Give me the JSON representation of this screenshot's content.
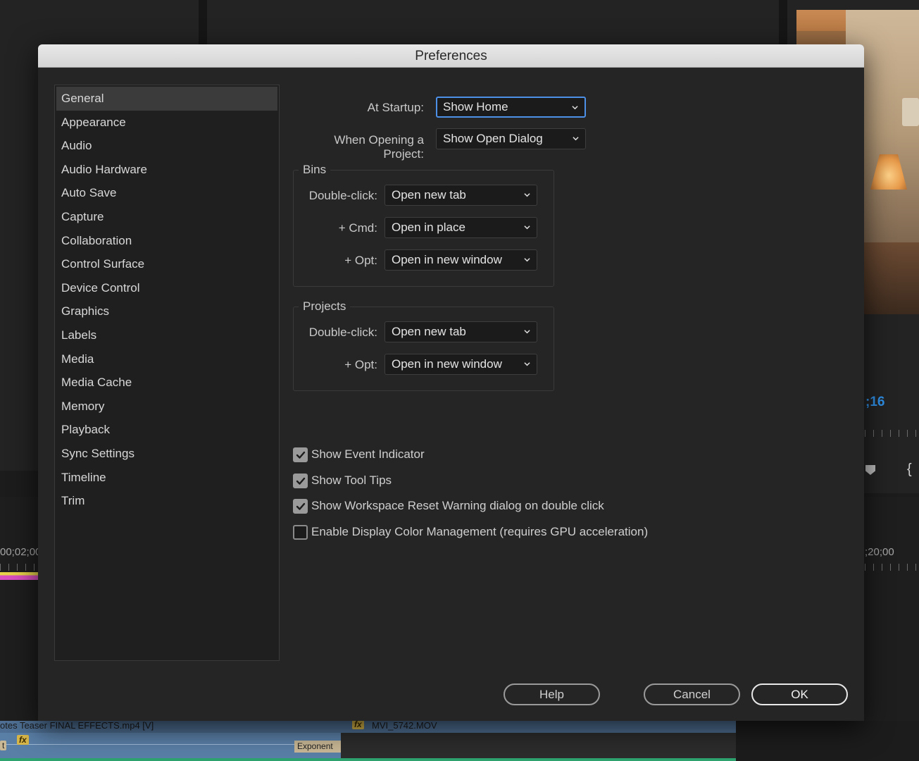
{
  "background": {
    "timecode": ";16",
    "timecode_left": "00;02;00",
    "timecode_right": ";20;00",
    "clip_label_1": "otes Teaser FINAL EFFECTS.mp4 [V]",
    "clip_label_2": "MVI_5742.MOV",
    "fx_label": "fx",
    "expo_label": "Exponent",
    "t_label": "t"
  },
  "dialog": {
    "title": "Preferences",
    "nav": [
      {
        "label": "General",
        "active": true
      },
      {
        "label": "Appearance"
      },
      {
        "label": "Audio"
      },
      {
        "label": "Audio Hardware"
      },
      {
        "label": "Auto Save"
      },
      {
        "label": "Capture"
      },
      {
        "label": "Collaboration"
      },
      {
        "label": "Control Surface"
      },
      {
        "label": "Device Control"
      },
      {
        "label": "Graphics"
      },
      {
        "label": "Labels"
      },
      {
        "label": "Media"
      },
      {
        "label": "Media Cache"
      },
      {
        "label": "Memory"
      },
      {
        "label": "Playback"
      },
      {
        "label": "Sync Settings"
      },
      {
        "label": "Timeline"
      },
      {
        "label": "Trim"
      }
    ],
    "general": {
      "at_startup_label": "At Startup:",
      "at_startup_value": "Show Home",
      "opening_project_label": "When Opening a Project:",
      "opening_project_value": "Show Open Dialog",
      "bins": {
        "title": "Bins",
        "double_click_label": "Double-click:",
        "double_click_value": "Open new tab",
        "cmd_label": "+ Cmd:",
        "cmd_value": "Open in place",
        "opt_label": "+ Opt:",
        "opt_value": "Open in new window"
      },
      "projects": {
        "title": "Projects",
        "double_click_label": "Double-click:",
        "double_click_value": "Open new tab",
        "opt_label": "+ Opt:",
        "opt_value": "Open in new window"
      },
      "checkboxes": [
        {
          "label": "Show Event Indicator",
          "checked": true
        },
        {
          "label": "Show Tool Tips",
          "checked": true
        },
        {
          "label": "Show Workspace Reset Warning dialog on double click",
          "checked": true
        },
        {
          "label": "Enable Display Color Management (requires GPU acceleration)",
          "checked": false
        }
      ]
    },
    "buttons": {
      "help": "Help",
      "cancel": "Cancel",
      "ok": "OK"
    },
    "colors": {
      "focus_ring": "#4d90e8",
      "timecode": "#2f8fe6"
    }
  }
}
